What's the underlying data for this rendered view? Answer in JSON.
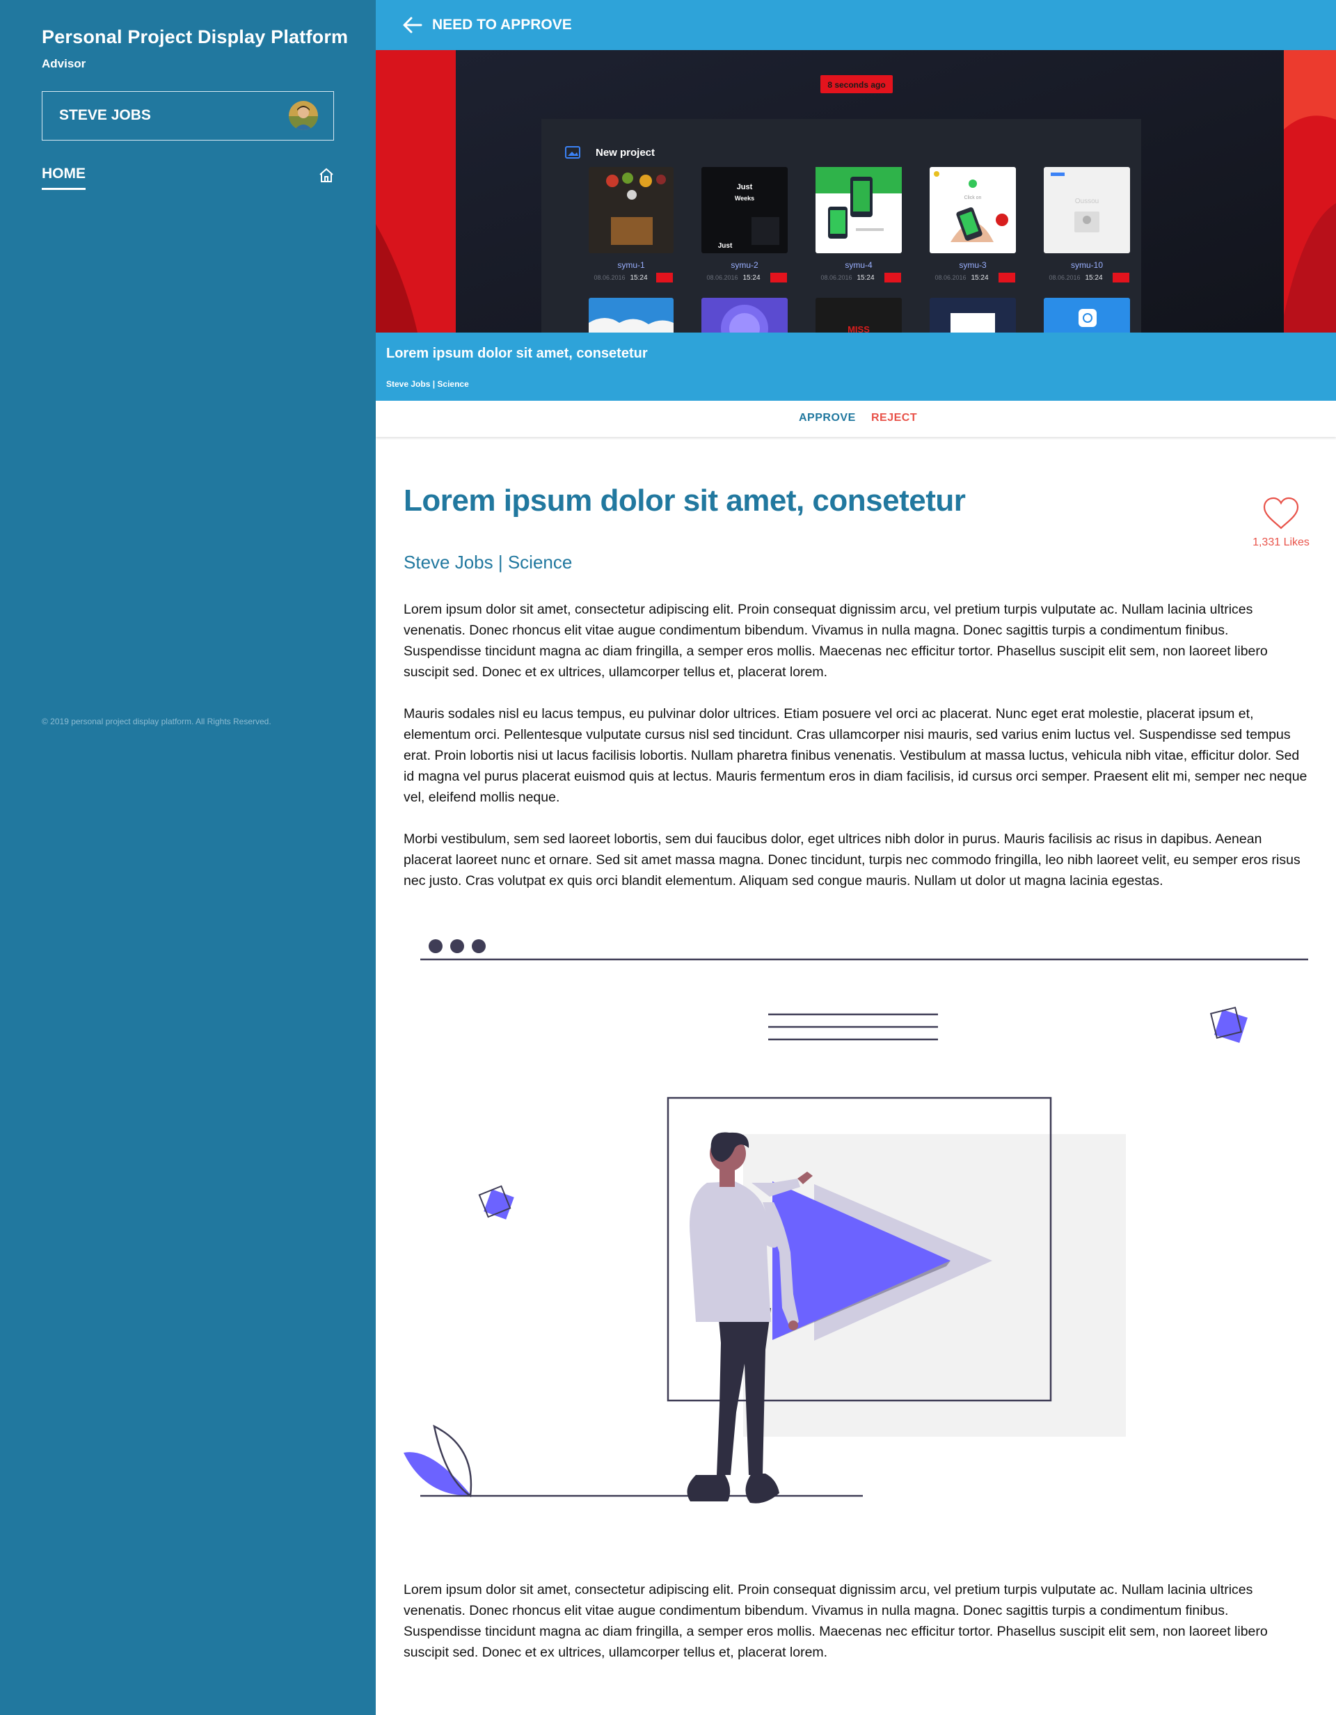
{
  "sidebar": {
    "brand": "Personal Project Display Platform",
    "role": "Advisor",
    "user_name": "STEVE JOBS",
    "nav": [
      {
        "label": "HOME",
        "icon": "home-icon"
      }
    ],
    "copyright": "© 2019 personal project display platform. All Rights Reserved."
  },
  "topbar": {
    "back_icon": "arrow-left-icon",
    "title": "NEED TO APPROVE"
  },
  "hero": {
    "badge": "8 seconds ago",
    "panel_title": "New project",
    "projects": [
      {
        "name": "symu-1",
        "date": "08.06.2016",
        "time": "15:24"
      },
      {
        "name": "symu-2",
        "date": "08.06.2016",
        "time": "15:24"
      },
      {
        "name": "symu-4",
        "date": "08.06.2016",
        "time": "15:24"
      },
      {
        "name": "symu-3",
        "date": "08.06.2016",
        "time": "15:24"
      },
      {
        "name": "symu-10",
        "date": "08.06.2016",
        "time": "15:24"
      }
    ],
    "thumb_texts": [
      "Just",
      "Weeks",
      "Just",
      "Click on",
      "Oussou",
      "MISS"
    ],
    "caption_title": "Lorem ipsum dolor sit amet, consetetur",
    "caption_meta": "Steve Jobs | Science"
  },
  "actions": {
    "approve": "APPROVE",
    "reject": "REJECT"
  },
  "article": {
    "title": "Lorem ipsum dolor sit amet, consetetur",
    "meta": "Steve Jobs | Science",
    "likes": "1,331 Likes",
    "like_icon": "heart-icon",
    "paragraphs": [
      "Lorem ipsum dolor sit amet, consectetur adipiscing elit. Proin consequat dignissim arcu, vel pretium turpis vulputate ac. Nullam lacinia ultrices venenatis. Donec rhoncus elit vitae augue condimentum bibendum. Vivamus in nulla magna. Donec sagittis turpis a condimentum finibus. Suspendisse tincidunt magna ac diam fringilla, a semper eros mollis. Maecenas nec efficitur tortor. Phasellus suscipit elit sem, non laoreet libero suscipit sed. Donec et ex ultrices, ullamcorper tellus et, placerat lorem.",
      "Mauris sodales nisl eu lacus tempus, eu pulvinar dolor ultrices. Etiam posuere vel orci ac placerat. Nunc eget erat molestie, placerat ipsum et, elementum orci. Pellentesque vulputate cursus nisl sed tincidunt. Cras ullamcorper nisi mauris, sed varius enim luctus vel. Suspendisse sed tempus erat. Proin lobortis nisi ut lacus facilisis lobortis. Nullam pharetra finibus venenatis. Vestibulum at massa luctus, vehicula nibh vitae, efficitur dolor. Sed id magna vel purus placerat euismod quis at lectus. Mauris fermentum eros in diam facilisis, id cursus orci semper. Praesent elit mi, semper nec neque vel, eleifend mollis neque.",
      "Morbi vestibulum, sem sed laoreet lobortis, sem dui faucibus dolor, eget ultrices nibh dolor in purus. Mauris facilisis ac risus in dapibus. Aenean placerat laoreet nunc et ornare. Sed sit amet massa magna. Donec tincidunt, turpis nec commodo fringilla, leo nibh laoreet velit, eu semper eros risus nec justo. Cras volutpat ex quis orci blandit elementum. Aliquam sed congue mauris. Nullam ut dolor ut magna lacinia egestas.",
      "Lorem ipsum dolor sit amet, consectetur adipiscing elit. Proin consequat dignissim arcu, vel pretium turpis vulputate ac. Nullam lacinia ultrices venenatis. Donec rhoncus elit vitae augue condimentum bibendum. Vivamus in nulla magna. Donec sagittis turpis a condimentum finibus. Suspendisse tincidunt magna ac diam fringilla, a semper eros mollis. Maecenas nec efficitur tortor. Phasellus suscipit elit sem, non laoreet libero suscipit sed. Donec et ex ultrices, ullamcorper tellus et, placerat lorem."
    ]
  },
  "colors": {
    "sidebar": "#21789f",
    "topbar": "#2ea3d9",
    "accent": "#21789f",
    "reject": "#e8534a",
    "illustration_purple": "#6c63ff",
    "illustration_dark": "#3f3d56"
  }
}
